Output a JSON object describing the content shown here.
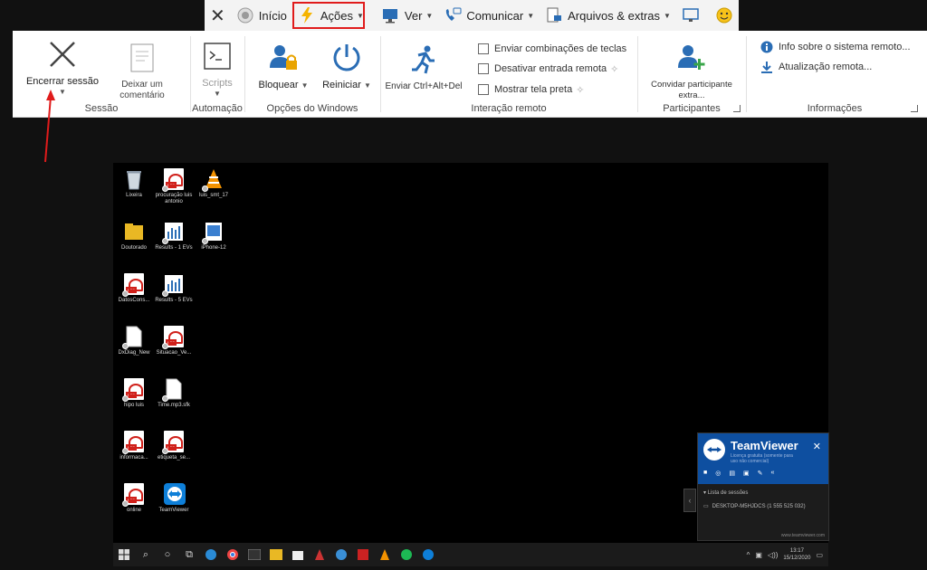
{
  "tabs": {
    "close": "✕",
    "inicio": "Início",
    "acoes": "Ações",
    "ver": "Ver",
    "comunicar": "Comunicar",
    "arquivos": "Arquivos & extras"
  },
  "ribbon": {
    "sessao": {
      "label": "Sessão",
      "encerrar": "Encerrar sessão",
      "comentario": "Deixar um comentário"
    },
    "automacao": {
      "label": "Automação",
      "scripts": "Scripts"
    },
    "windows": {
      "label": "Opções do Windows",
      "bloquear": "Bloquear",
      "reiniciar": "Reiniciar"
    },
    "interacao": {
      "label": "Interação remoto",
      "enviar_cad": "Enviar Ctrl+Alt+Del",
      "opt1": "Enviar combinações de teclas",
      "opt2": "Desativar entrada remota",
      "opt3": "Mostrar tela preta"
    },
    "participantes": {
      "label": "Participantes",
      "convidar": "Convidar participante extra..."
    },
    "informacoes": {
      "label": "Informações",
      "info_sistema": "Info sobre o sistema remoto...",
      "atualizacao": "Atualização remota..."
    }
  },
  "desktop_icons": [
    {
      "label": "Lixeira",
      "kind": "recycle"
    },
    {
      "label": "procuração luis antonio",
      "kind": "pdf"
    },
    {
      "label": "luis_smt_17",
      "kind": "vlc"
    },
    {
      "label": "Doutorado",
      "kind": "folder"
    },
    {
      "label": "Results - 1 EVs",
      "kind": "chart"
    },
    {
      "label": "iPhone-12",
      "kind": "image"
    },
    {
      "label": "DatosCons...",
      "kind": "pdf"
    },
    {
      "label": "Results - 5 EVs",
      "kind": "chart"
    },
    {
      "label": "DxDiag_New",
      "kind": "file"
    },
    {
      "label": "Situacao_Ve...",
      "kind": "pdf"
    },
    {
      "label": "hipo luis",
      "kind": "pdf"
    },
    {
      "label": "Time.mp3.sfk",
      "kind": "file"
    },
    {
      "label": "informaca...",
      "kind": "pdf"
    },
    {
      "label": "etiqueta_se...",
      "kind": "pdf"
    },
    {
      "label": "online",
      "kind": "pdf"
    },
    {
      "label": "TeamViewer",
      "kind": "teamviewer"
    }
  ],
  "teamviewer": {
    "title": "TeamViewer",
    "subtitle": "Licença gratuita (somente para uso não comercial)",
    "close": "✕",
    "session_list": "Lista de sessões",
    "session_item": "DESKTOP-M5HJDCS (1 555 525 032)",
    "footer": "www.teamviewer.com"
  },
  "taskbar": {
    "time": "13:17",
    "date": "15/12/2020"
  },
  "colors": {
    "highlight": "#e01b1b",
    "teamviewer_blue": "#0e4fa0"
  }
}
